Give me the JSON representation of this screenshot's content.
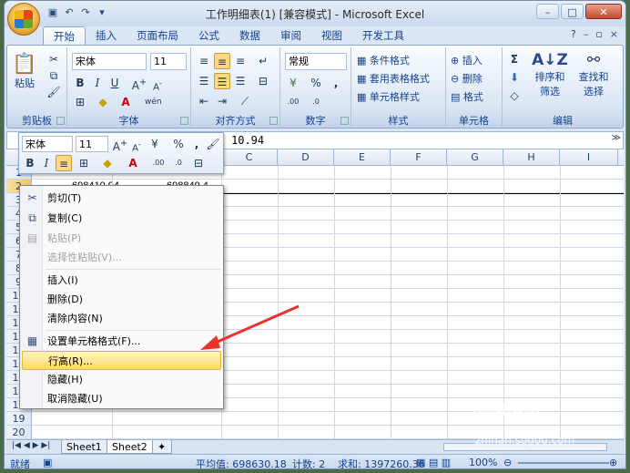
{
  "window": {
    "title": "工作明细表(1)  [兼容模式] - Microsoft Excel"
  },
  "quick_access": [
    "save-icon",
    "undo-icon",
    "redo-icon",
    "customize-icon"
  ],
  "window_controls": [
    "minimize-icon",
    "maximize-icon",
    "close-icon"
  ],
  "ribbon_tabs": [
    "开始",
    "插入",
    "页面布局",
    "公式",
    "数据",
    "审阅",
    "视图",
    "开发工具"
  ],
  "ribbon": {
    "clipboard": {
      "paste": "粘贴",
      "label": "剪贴板"
    },
    "font": {
      "name": "宋体",
      "size": "11",
      "label": "字体"
    },
    "alignment": {
      "label": "对齐方式"
    },
    "number": {
      "format": "常规",
      "label": "数字",
      "percent": "%"
    },
    "styles": {
      "conditional": "条件格式",
      "table": "套用表格格式",
      "cell": "单元格样式",
      "label": "样式"
    },
    "cells": {
      "insert": "插入",
      "delete": "删除",
      "format": "格式",
      "label": "单元格"
    },
    "editing": {
      "sort": "排序和",
      "filter": "筛选",
      "find": "查找和",
      "select": "选择",
      "label": "编辑"
    }
  },
  "formula_bar": {
    "value": "10.94"
  },
  "mini_toolbar": {
    "font": "宋体",
    "size": "11",
    "percent": "%",
    "comma": ","
  },
  "columns": [
    "C",
    "D",
    "E",
    "F",
    "G",
    "H",
    "I"
  ],
  "rows": [
    "1",
    "2",
    "3",
    "4",
    "5",
    "6",
    "7",
    "8",
    "9",
    "10",
    "11",
    "12",
    "13",
    "14",
    "15",
    "16",
    "17",
    "18",
    "19",
    "20"
  ],
  "cells": {
    "a2": "698410.94",
    "b2": "698849.4"
  },
  "context_menu": {
    "cut": "剪切(T)",
    "copy": "复制(C)",
    "paste": "粘贴(P)",
    "paste_special": "选择性粘贴(V)...",
    "insert": "插入(I)",
    "delete": "删除(D)",
    "clear": "清除内容(N)",
    "format_cells": "设置单元格格式(F)...",
    "row_height": "行高(R)...",
    "hide": "隐藏(H)",
    "unhide": "取消隐藏(U)"
  },
  "sheets": [
    "Sheet1",
    "Sheet2"
  ],
  "status": {
    "ready": "就绪",
    "average": "平均值: 698630.18",
    "count": "计数: 2",
    "sum": "求和: 1397260.36",
    "zoom": "100%"
  },
  "watermark": {
    "brand": "搜狗指南",
    "url": "zhinan.sogou.com"
  },
  "colors": {
    "highlight": "#fcd969",
    "arrow": "#e8322b",
    "ribbon": "#dbe6f4"
  }
}
